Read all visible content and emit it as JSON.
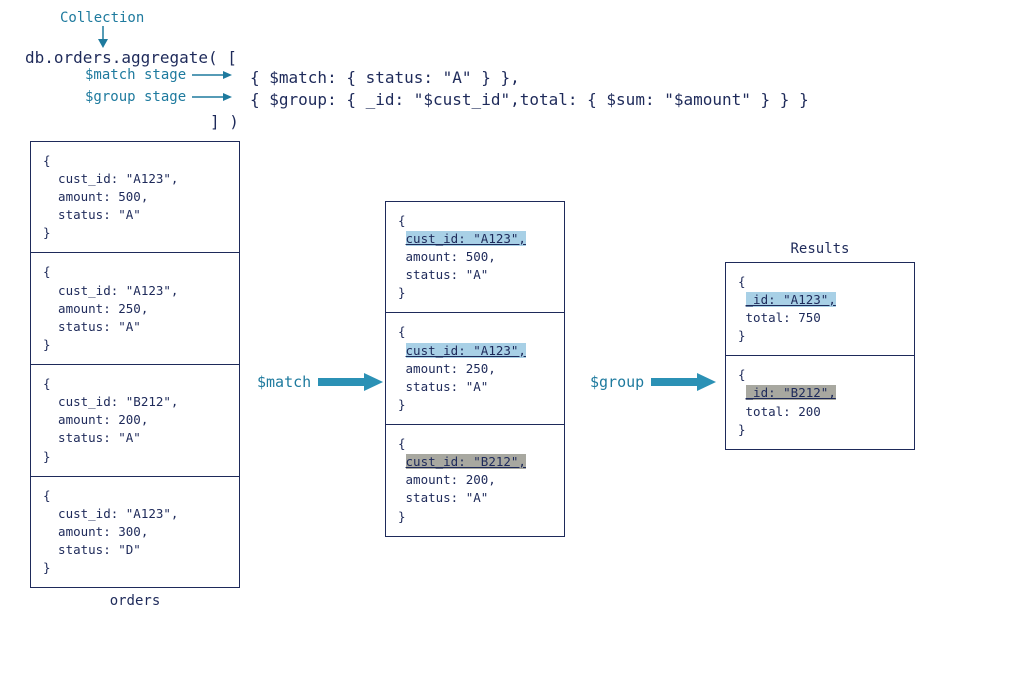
{
  "header": {
    "collection_label": "Collection",
    "code_line1": "db.orders.aggregate( [",
    "match_stage_label": "$match stage",
    "group_stage_label": "$group stage",
    "code_match": "{ $match: { status: \"A\" } },",
    "code_group": "{ $group: { _id: \"$cust_id\",total: { $sum: \"$amount\" } } }",
    "code_close": "] )"
  },
  "flow": {
    "match_label": "$match",
    "group_label": "$group"
  },
  "orders": {
    "label": "orders",
    "docs": [
      {
        "open": "{",
        "l1": "  cust_id: \"A123\",",
        "l2": "  amount: 500,",
        "l3": "  status: \"A\"",
        "close": "}"
      },
      {
        "open": "{",
        "l1": "  cust_id: \"A123\",",
        "l2": "  amount: 250,",
        "l3": "  status: \"A\"",
        "close": "}"
      },
      {
        "open": "{",
        "l1": "  cust_id: \"B212\",",
        "l2": "  amount: 200,",
        "l3": "  status: \"A\"",
        "close": "}"
      },
      {
        "open": "{",
        "l1": "  cust_id: \"A123\",",
        "l2": "  amount: 300,",
        "l3": "  status: \"D\"",
        "close": "}"
      }
    ]
  },
  "matched": {
    "docs": [
      {
        "open": "{",
        "hl": "cust_id: \"A123\",",
        "l2": " amount: 500,",
        "l3": " status: \"A\"",
        "close": "}",
        "hlclass": "hl-blue"
      },
      {
        "open": "{",
        "hl": "cust_id: \"A123\",",
        "l2": " amount: 250,",
        "l3": " status: \"A\"",
        "close": "}",
        "hlclass": "hl-blue"
      },
      {
        "open": "{",
        "hl": "cust_id: \"B212\",",
        "l2": " amount: 200,",
        "l3": " status: \"A\"",
        "close": "}",
        "hlclass": "hl-gray"
      }
    ]
  },
  "results": {
    "label": "Results",
    "docs": [
      {
        "open": "{",
        "hl": "_id: \"A123\",",
        "l2": " total: 750",
        "close": "}",
        "hlclass": "hl-blue"
      },
      {
        "open": "{",
        "hl": "_id: \"B212\",",
        "l2": " total: 200",
        "close": "}",
        "hlclass": "hl-gray"
      }
    ]
  }
}
